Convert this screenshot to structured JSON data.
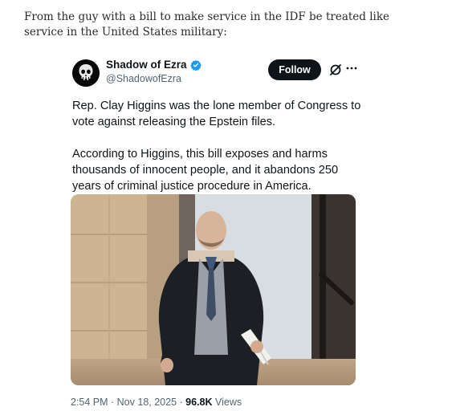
{
  "post": {
    "intro": "From the guy with a bill to make service in the IDF be treated like service in the United States military:"
  },
  "tweet": {
    "author_name": "Shadow of Ezra",
    "handle": "@ShadowofEzra",
    "follow_label": "Follow",
    "paragraphs": [
      "Rep. Clay Higgins was the lone member of Congress to vote against releasing the Epstein files.",
      "According to Higgins, this bill exposes and harms thousands of innocent people, and it abandons 250 years of criminal justice procedure in America."
    ],
    "timestamp": "2:54 PM · Nov 18, 2025 · ",
    "views_count": "96.8K",
    "views_label": " Views",
    "icons": [
      "skull-avatar-icon",
      "verified-badge-icon",
      "grok-icon",
      "more-icon"
    ],
    "colors": {
      "follow_bg": "#0f1419",
      "verified": "#1d9bf0",
      "meta": "#536471"
    }
  }
}
